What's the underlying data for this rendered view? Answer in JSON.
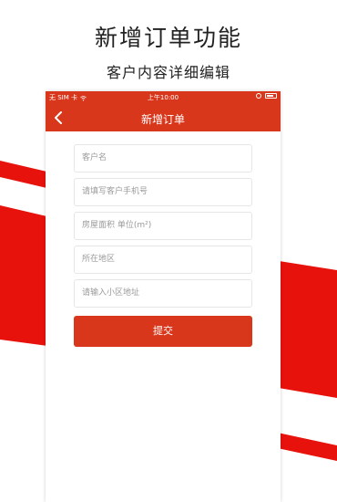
{
  "promo": {
    "title": "新增订单功能",
    "subtitle": "客户内容详细编辑"
  },
  "status_bar": {
    "carrier": "无 SIM 卡",
    "time": "上午10:00",
    "icons": [
      "wifi-icon",
      "lock-rotation-icon",
      "battery-icon"
    ]
  },
  "nav": {
    "title": "新增订单",
    "back_icon": "chevron-left-icon"
  },
  "form": {
    "customer_name_placeholder": "客户名",
    "phone_placeholder": "请填写客户手机号",
    "area_placeholder": "房屋面积 单位(m²)",
    "region_placeholder": "所在地区",
    "address_placeholder": "请输入小区地址",
    "submit_label": "提交"
  },
  "colors": {
    "accent": "#d8371b",
    "stripe": "#e8120d",
    "text": "#222222",
    "placeholder": "#9a9a9a",
    "field_border": "#e6e6e6"
  }
}
